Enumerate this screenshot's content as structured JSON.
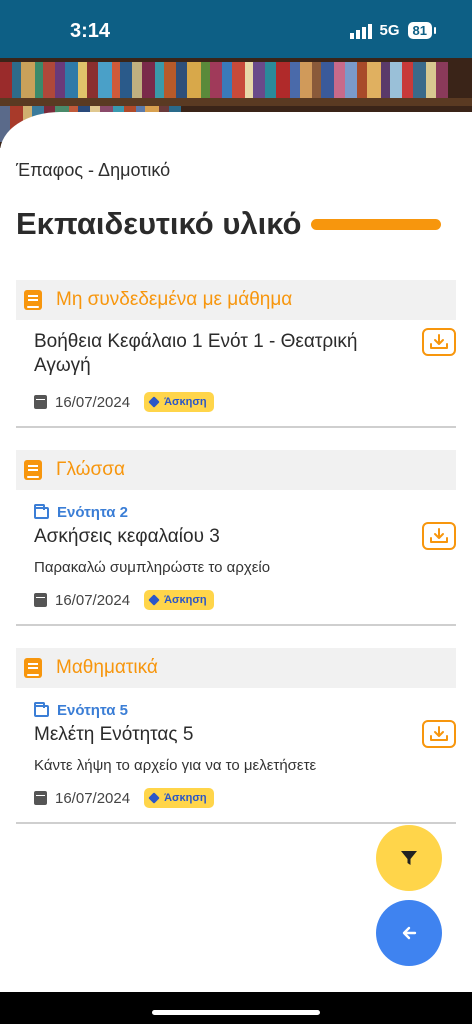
{
  "status_bar": {
    "time": "3:14",
    "network": "5G",
    "battery": "81"
  },
  "breadcrumb": "Έπαφος - Δημοτικό",
  "page_title": "Εκπαιδευτικό υλικό",
  "colors": {
    "accent": "#f7960d",
    "header_bar": "#0d5f85",
    "unit_blue": "#3b7ed6",
    "tag_yellow": "#ffd54a",
    "fab_back": "#3f83f0"
  },
  "sections": [
    {
      "title": "Μη συνδεδεμένα με μάθημα",
      "icon": "book-icon",
      "items": [
        {
          "unit": "",
          "title": "Βοήθεια Κεφάλαιο 1 Ενότ 1 - Θεατρική Αγωγή",
          "description": "",
          "date": "16/07/2024",
          "tag": "Άσκηση"
        }
      ]
    },
    {
      "title": "Γλώσσα",
      "icon": "book-icon",
      "items": [
        {
          "unit": "Ενότητα 2",
          "title": "Ασκήσεις κεφαλαίου 3",
          "description": "Παρακαλώ συμπληρώστε το αρχείο",
          "date": "16/07/2024",
          "tag": "Άσκηση"
        }
      ]
    },
    {
      "title": "Μαθηματικά",
      "icon": "book-icon",
      "items": [
        {
          "unit": "Ενότητα 5",
          "title": "Μελέτη Ενότητας 5",
          "description": "Κάντε λήψη το αρχείο για να το μελετήσετε",
          "date": "16/07/2024",
          "tag": "Άσκηση"
        }
      ]
    }
  ],
  "fabs": {
    "filter_icon": "filter-icon",
    "back_icon": "arrow-left-icon"
  }
}
